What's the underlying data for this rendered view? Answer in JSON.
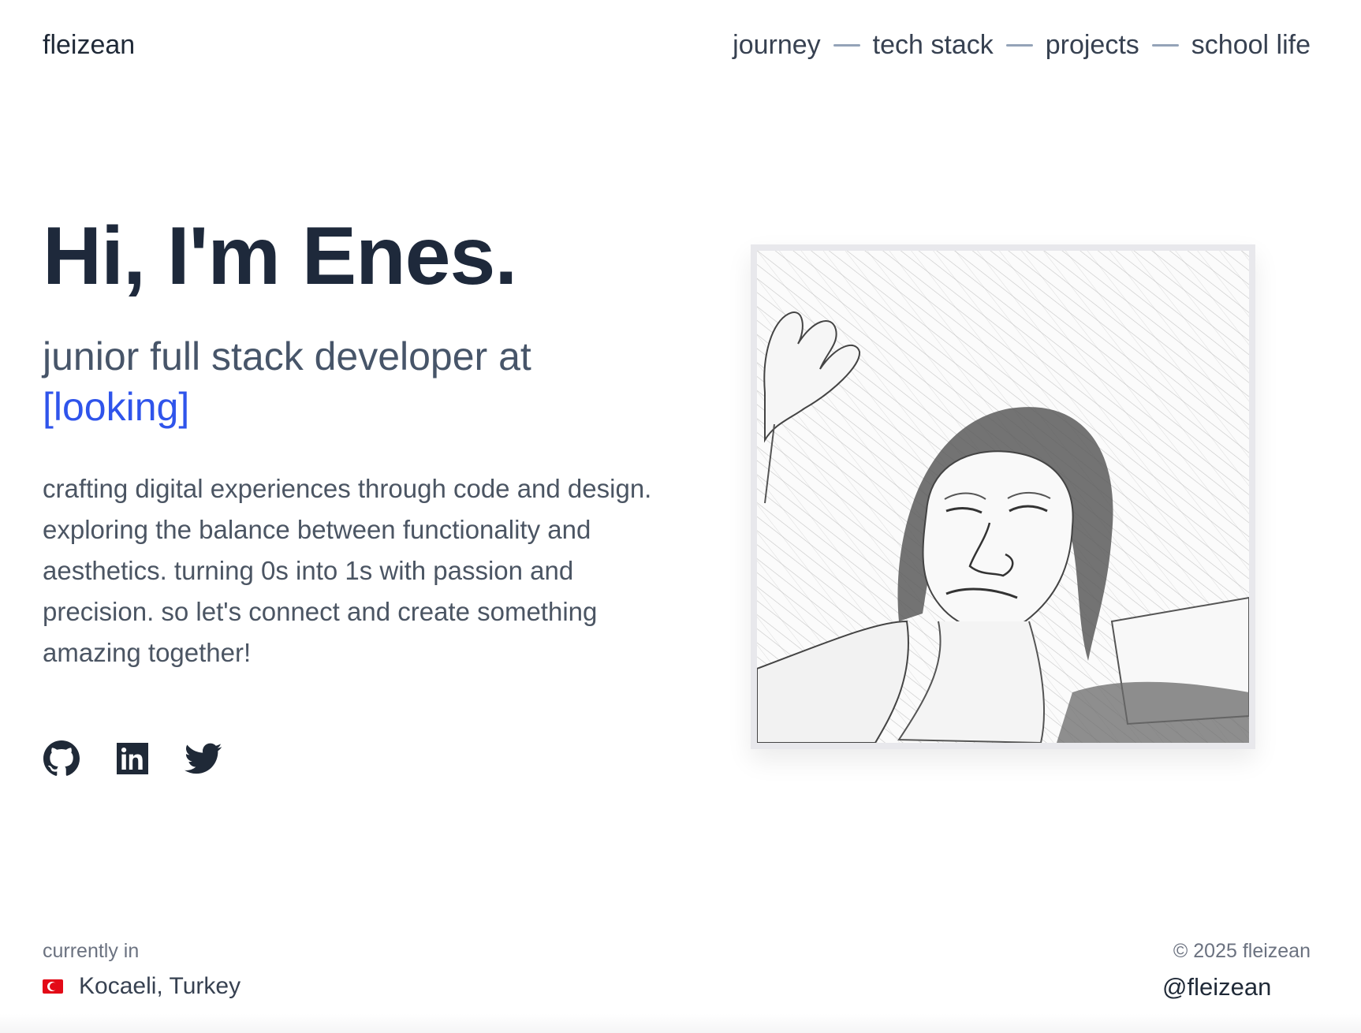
{
  "brand": "fleizean",
  "nav": {
    "items": [
      {
        "label": "journey"
      },
      {
        "label": "tech stack"
      },
      {
        "label": "projects"
      },
      {
        "label": "school life"
      }
    ]
  },
  "hero": {
    "heading": "Hi, I'm Enes.",
    "subtitle": "junior full stack developer at",
    "status": "[looking]",
    "description": "crafting digital experiences through code and design. exploring the balance between functionality and aesthetics. turning 0s into 1s with passion and precision. so let's connect and create something amazing together!"
  },
  "social": [
    {
      "icon": "github-icon"
    },
    {
      "icon": "linkedin-icon"
    },
    {
      "icon": "twitter-icon"
    }
  ],
  "footer": {
    "location_label": "currently in",
    "location": "Kocaeli, Turkey",
    "copyright": "© 2025 fleizean",
    "handle": "@fleizean"
  },
  "colors": {
    "accent": "#2f54eb",
    "text": "#1e293b",
    "muted": "#6b7280"
  }
}
